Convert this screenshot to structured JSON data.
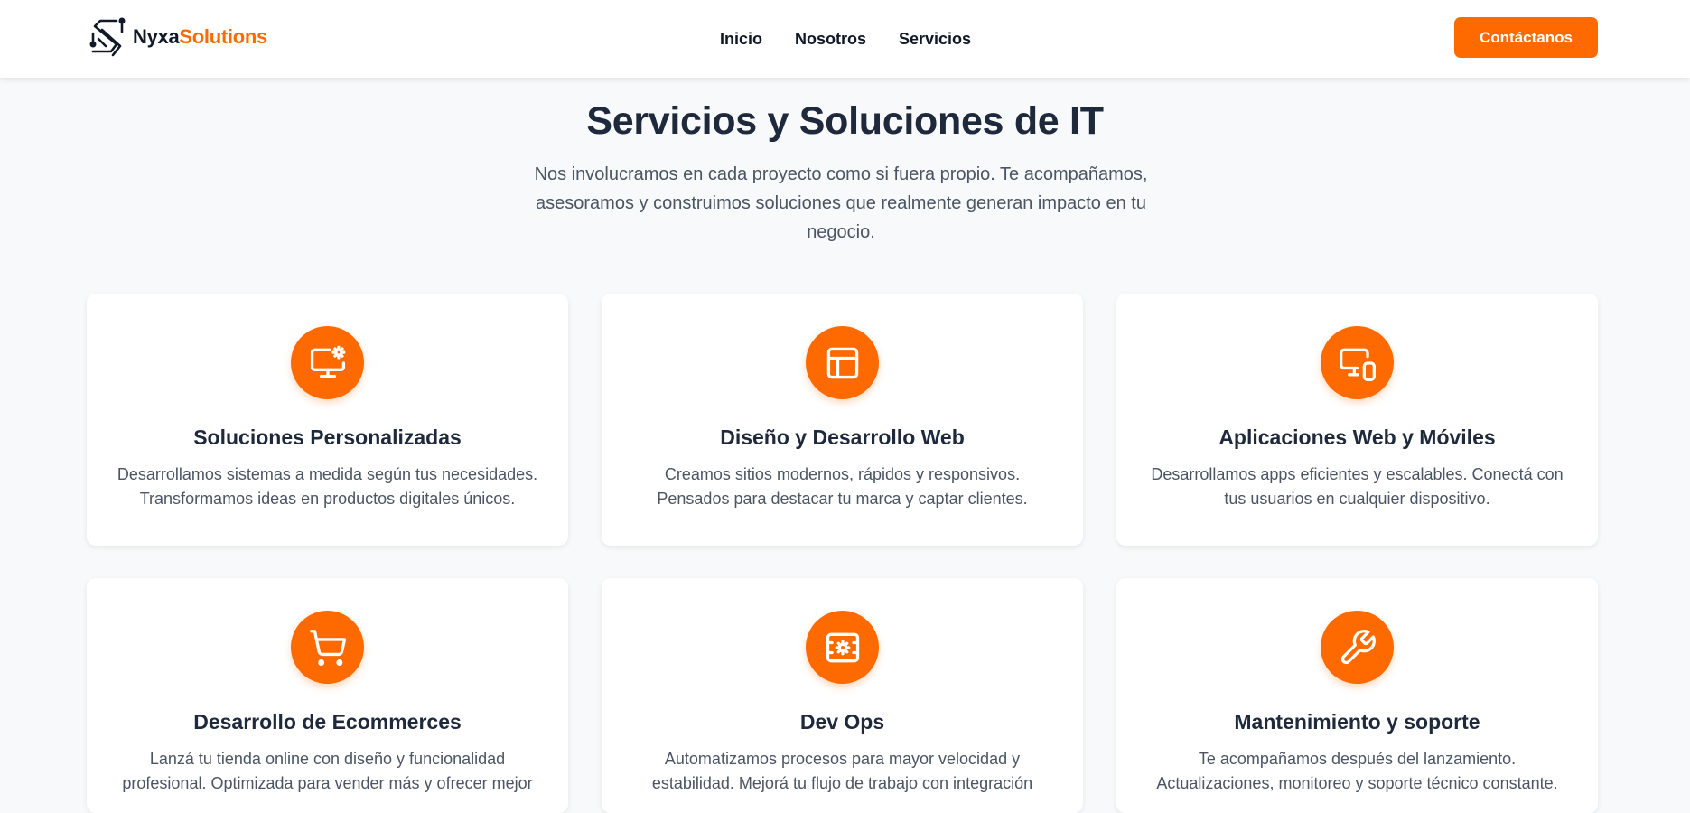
{
  "brand": {
    "name_part1": "Nyxa",
    "name_part2": "Solutions",
    "accent_color": "#ff6a00",
    "logo_icon": "nyxa-s-circuit-logo"
  },
  "nav": {
    "items": [
      {
        "label": "Inicio"
      },
      {
        "label": "Nosotros"
      },
      {
        "label": "Servicios"
      }
    ],
    "cta_label": "Contáctanos"
  },
  "hero": {
    "title": "Servicios y Soluciones de IT",
    "subtitle": "Nos involucramos en cada proyecto como si fuera propio. Te acompañamos, asesoramos y construimos soluciones que realmente generan impacto en tu negocio."
  },
  "services": [
    {
      "icon": "monitor-gear-icon",
      "title": "Soluciones Personalizadas",
      "description": "Desarrollamos sistemas a medida según tus necesidades. Transformamos ideas en productos digitales únicos."
    },
    {
      "icon": "layout-icon",
      "title": "Diseño y Desarrollo Web",
      "description": "Creamos sitios modernos, rápidos y responsivos. Pensados para destacar tu marca y captar clientes."
    },
    {
      "icon": "devices-icon",
      "title": "Aplicaciones Web y Móviles",
      "description": "Desarrollamos apps eficientes y escalables. Conectá con tus usuarios en cualquier dispositivo."
    },
    {
      "icon": "shopping-cart-icon",
      "title": "Desarrollo de Ecommerces",
      "description": "Lanzá tu tienda online con diseño y funcionalidad profesional. Optimizada para vender más y ofrecer mejor"
    },
    {
      "icon": "server-gear-icon",
      "title": "Dev Ops",
      "description": "Automatizamos procesos para mayor velocidad y estabilidad. Mejorá tu flujo de trabajo con integración"
    },
    {
      "icon": "wrench-icon",
      "title": "Mantenimiento y soporte",
      "description": "Te acompañamos después del lanzamiento. Actualizaciones, monitoreo y soporte técnico constante."
    }
  ]
}
